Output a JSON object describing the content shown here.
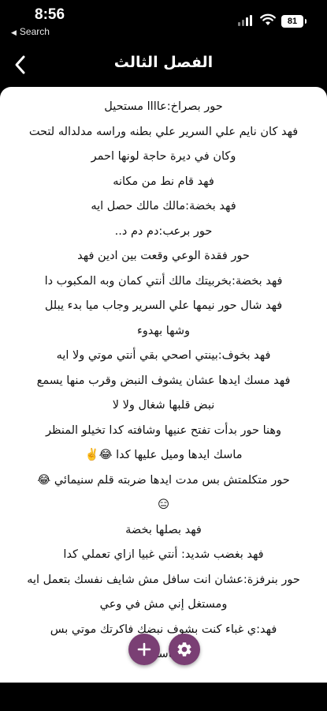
{
  "status_bar": {
    "time": "8:56",
    "back_app": "Search",
    "battery": "81"
  },
  "app_bar": {
    "title": "الفصل الثالث",
    "back_icon": "chevron-left-icon"
  },
  "content": {
    "lines": [
      "حور بصراخ:عاااا مستحيل",
      "فهد كان نايم علي السرير علي بطنه وراسه مدلداله لتحت",
      "وكان في ديرة حاجة لونها احمر",
      "فهد قام نط من مكانه",
      "فهد بخضة:مالك مالك حصل ايه",
      "حور برعب:دم دم د..",
      "حور فقدة الوعي وقعت بين ادين فهد",
      "فهد بخضة:بخربيتك مالك أنتي كمان وبه المكبوب دا",
      "فهد شال حور نيمها علي السرير وجاب ميا بدء يبلل",
      "وشها بهدوء",
      "فهد بخوف:بينتي اصحي بقي أنتي موتي ولا ايه",
      "فهد مسك ايدها عشان يشوف النبض وقرب منها يسمع",
      "نبض قلبها شغال ولا لا",
      "وهنا حور بدأت تفتح عنيها وشافته كدا تخيلو المنظر",
      "ماسك ايدها وميل عليها كدا 😂✌️",
      "حور متكلمتش بس مدت ايدها ضربته قلم سنيمائي 😂",
      "😑",
      "فهد بصلها بخضة",
      "فهد بغضب شديد: أنتي غبيا ازاي تعملي كدا",
      "حور بنرفزة:عشان انت سافل مش شايف نفسك بتعمل ايه",
      "ومستغل إني مش في وعي",
      "فهد:ي غباء كنت بشوف نبضك فاكرتك موتي بس",
      "ماسك"
    ]
  },
  "fabs": {
    "add_icon": "plus-icon",
    "settings_icon": "gear-icon",
    "color": "#7a3f74"
  }
}
